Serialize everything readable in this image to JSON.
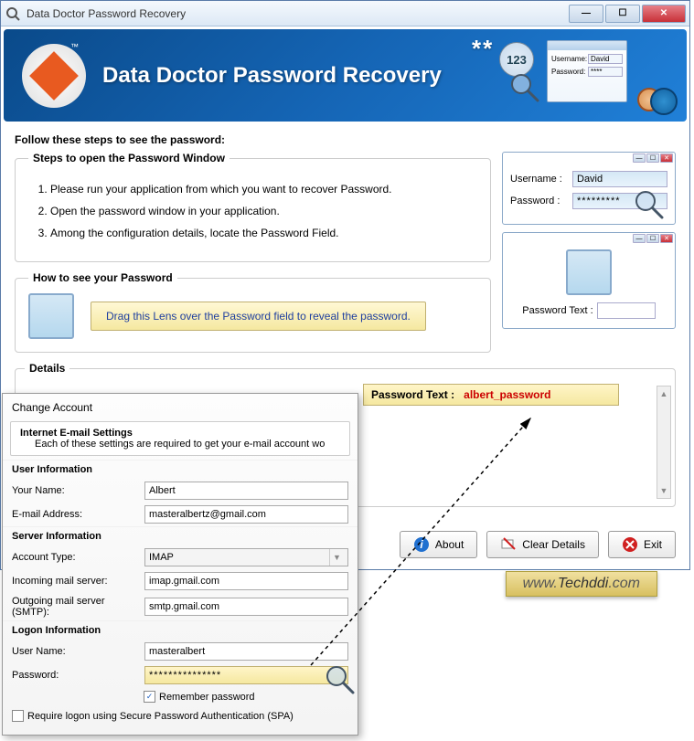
{
  "titlebar": {
    "title": "Data Doctor Password Recovery"
  },
  "banner": {
    "title": "Data Doctor Password Recovery",
    "stars": "**",
    "badge": "123",
    "miniUsernameLabel": "Username:",
    "miniUsernameValue": "David",
    "miniPasswordLabel": "Password:",
    "miniPasswordValue": "****"
  },
  "content": {
    "heading": "Follow these steps to see the password:",
    "stepsLegend": "Steps to open the Password Window",
    "steps": [
      "Please run your application from which you want to recover Password.",
      "Open the password window in your application.",
      "Among the configuration details, locate the Password Field."
    ],
    "howtoLegend": "How to see your Password",
    "dragHint": "Drag this Lens over the Password field to reveal the password."
  },
  "rightPane": {
    "usernameLabel": "Username :",
    "usernameValue": "David",
    "passwordLabel": "Password :",
    "passwordValue": "*********",
    "passwordTextLabel": "Password Text :"
  },
  "details": {
    "legend": "Details",
    "resultLabel": "Password Text :",
    "resultValue": "albert_password"
  },
  "buttons": {
    "about": "About",
    "clear": "Clear Details",
    "exit": "Exit"
  },
  "watermark": {
    "prefix": "www.",
    "name": "Techddi",
    "suffix": ".com"
  },
  "overlay": {
    "title": "Change Account",
    "settingsTitle": "Internet E-mail Settings",
    "settingsSub": "Each of these settings are required to get your e-mail account wo",
    "userInfo": "User Information",
    "yourNameLabel": "Your Name:",
    "yourNameValue": "Albert",
    "emailLabel": "E-mail Address:",
    "emailValue": "masteralbertz@gmail.com",
    "serverInfo": "Server Information",
    "acctTypeLabel": "Account Type:",
    "acctTypeValue": "IMAP",
    "incomingLabel": "Incoming mail server:",
    "incomingValue": "imap.gmail.com",
    "outgoingLabel": "Outgoing mail server (SMTP):",
    "outgoingValue": "smtp.gmail.com",
    "logonInfo": "Logon Information",
    "userNameLabel": "User Name:",
    "userNameValue": "masteralbert",
    "passwordLabel": "Password:",
    "passwordValue": "***************",
    "rememberLabel": "Remember password",
    "spaLabel": "Require logon using Secure Password Authentication (SPA)"
  }
}
